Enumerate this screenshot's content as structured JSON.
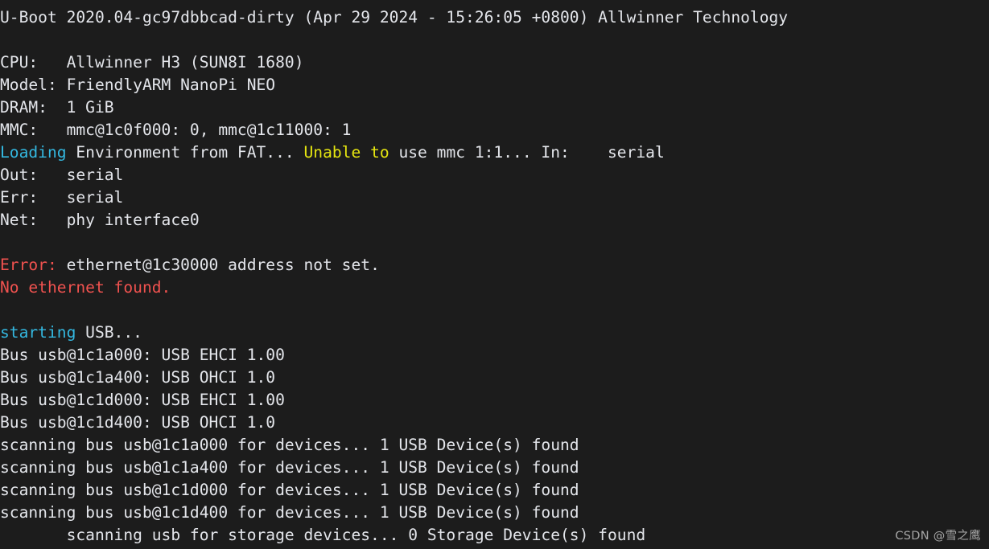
{
  "terminal": {
    "title": "U-Boot Serial Console",
    "background_color": "#1c1c1c",
    "foreground_color": "#e4e6eb",
    "colors": {
      "white": "#e4e6eb",
      "cyan": "#34b8e0",
      "yellow": "#e5e510",
      "red": "#f0524f"
    },
    "font_size_px": 19.6,
    "line_height_px": 28,
    "lines": [
      {
        "index": 0,
        "segments": [
          {
            "text": "U-Boot 2020.04-gc97dbbcad-dirty (Apr 29 2024 - 15:26:05 +0800) Allwinner Technology",
            "color": "white"
          }
        ]
      },
      {
        "index": 1,
        "segments": [
          {
            "text": "",
            "color": "white"
          }
        ]
      },
      {
        "index": 2,
        "segments": [
          {
            "text": "CPU:   Allwinner H3 (SUN8I 1680)",
            "color": "white"
          }
        ]
      },
      {
        "index": 3,
        "segments": [
          {
            "text": "Model: FriendlyARM NanoPi NEO",
            "color": "white"
          }
        ]
      },
      {
        "index": 4,
        "segments": [
          {
            "text": "DRAM:  1 GiB",
            "color": "white"
          }
        ]
      },
      {
        "index": 5,
        "segments": [
          {
            "text": "MMC:   mmc@1c0f000: 0, mmc@1c11000: 1",
            "color": "white"
          }
        ]
      },
      {
        "index": 6,
        "segments": [
          {
            "text": "Loading",
            "color": "cyan"
          },
          {
            "text": " Environment from FAT... ",
            "color": "white"
          },
          {
            "text": "Unable to",
            "color": "yellow"
          },
          {
            "text": " use mmc 1:1... In:    serial",
            "color": "white"
          }
        ]
      },
      {
        "index": 7,
        "segments": [
          {
            "text": "Out:   serial",
            "color": "white"
          }
        ]
      },
      {
        "index": 8,
        "segments": [
          {
            "text": "Err:   serial",
            "color": "white"
          }
        ]
      },
      {
        "index": 9,
        "segments": [
          {
            "text": "Net:   phy interface0",
            "color": "white"
          }
        ]
      },
      {
        "index": 10,
        "segments": [
          {
            "text": "",
            "color": "white"
          }
        ]
      },
      {
        "index": 11,
        "segments": [
          {
            "text": "Error:",
            "color": "red"
          },
          {
            "text": " ethernet@1c30000 address not set.",
            "color": "white"
          }
        ]
      },
      {
        "index": 12,
        "segments": [
          {
            "text": "No ethernet found.",
            "color": "red"
          }
        ]
      },
      {
        "index": 13,
        "segments": [
          {
            "text": "",
            "color": "white"
          }
        ]
      },
      {
        "index": 14,
        "segments": [
          {
            "text": "starting",
            "color": "cyan"
          },
          {
            "text": " USB...",
            "color": "white"
          }
        ]
      },
      {
        "index": 15,
        "segments": [
          {
            "text": "Bus usb@1c1a000: USB EHCI 1.00",
            "color": "white"
          }
        ]
      },
      {
        "index": 16,
        "segments": [
          {
            "text": "Bus usb@1c1a400: USB OHCI 1.0",
            "color": "white"
          }
        ]
      },
      {
        "index": 17,
        "segments": [
          {
            "text": "Bus usb@1c1d000: USB EHCI 1.00",
            "color": "white"
          }
        ]
      },
      {
        "index": 18,
        "segments": [
          {
            "text": "Bus usb@1c1d400: USB OHCI 1.0",
            "color": "white"
          }
        ]
      },
      {
        "index": 19,
        "segments": [
          {
            "text": "scanning bus usb@1c1a000 for devices... 1 USB Device(s) found",
            "color": "white"
          }
        ]
      },
      {
        "index": 20,
        "segments": [
          {
            "text": "scanning bus usb@1c1a400 for devices... 1 USB Device(s) found",
            "color": "white"
          }
        ]
      },
      {
        "index": 21,
        "segments": [
          {
            "text": "scanning bus usb@1c1d000 for devices... 1 USB Device(s) found",
            "color": "white"
          }
        ]
      },
      {
        "index": 22,
        "segments": [
          {
            "text": "scanning bus usb@1c1d400 for devices... 1 USB Device(s) found",
            "color": "white"
          }
        ]
      },
      {
        "index": 23,
        "segments": [
          {
            "text": "       scanning usb for storage devices... 0 Storage Device(s) found",
            "color": "white"
          }
        ]
      }
    ]
  },
  "watermark": {
    "text": "CSDN @雪之鹰",
    "color": "#b9b9b9"
  }
}
